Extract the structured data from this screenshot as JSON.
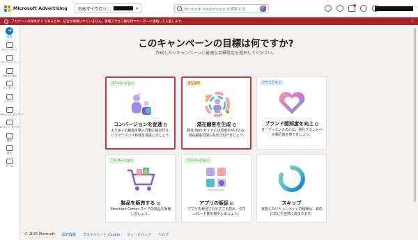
{
  "brand": {
    "name": "Microsoft Advertising",
    "logo_colors": [
      "#f25022",
      "#7fba00",
      "#00a4ef",
      "#ffb900"
    ]
  },
  "account": {
    "name": "日本マイクロソ..."
  },
  "search": {
    "placeholder": "Microsoft Advertising を検索する"
  },
  "top_icons": [
    "lightbulb-icon",
    "megaphone-icon",
    "bell-icon",
    "help-icon",
    "gear-icon"
  ],
  "alert": {
    "text": "アカウントの残高が 0 であるため、広告が掲載されていません。管理アクセス権を持つユーザーに連絡して入金します。",
    "color": "#a4262c"
  },
  "sidebar": {
    "items": [
      {
        "label": "作成",
        "icon": "plus-icon"
      },
      {
        "label": "キャンペーン",
        "icon": "megaphone-icon"
      },
      {
        "label": "コンバージョン",
        "icon": "conversion-icon"
      },
      {
        "label": "Ads Studio",
        "icon": "studio-icon"
      },
      {
        "label": "インポート",
        "icon": "import-icon"
      },
      {
        "label": "レポート",
        "icon": "report-icon"
      },
      {
        "label": "マーチャント センター",
        "icon": "store-icon"
      },
      {
        "label": "プロパティ センター",
        "icon": "property-icon"
      },
      {
        "label": "請求",
        "icon": "billing-icon"
      },
      {
        "label": "設定",
        "icon": "settings-icon"
      },
      {
        "label": "ツール",
        "icon": "tools-icon"
      }
    ]
  },
  "page": {
    "title": "このキャンペーンの目標は何ですか?",
    "subtitle": "作成したいキャンペーンに最適な目標設定を選択してください。"
  },
  "cards": [
    {
      "badge": "コンバージョン",
      "title": "コンバージョンを促進",
      "desc": "より多くの顧客を購入行動に結び付け、パフォーマンス目標を達成しましょう。",
      "selected": true
    },
    {
      "badge": "潜在顧客",
      "title": "潜在顧客を生成",
      "desc": "貴社 Web サイトに訪問者を呼び込み、潜在顧客の関心を引き付けましょう。",
      "selected": true
    },
    {
      "badge": "アウェアネス",
      "title": "ブランド認知度を向上",
      "desc": "オーディエンスの心に、貴社ブランドへの親近感を育てましょう。",
      "selected": false
    },
    {
      "badge": "コンバージョン",
      "title": "製品を販売する",
      "desc": "Merchant Center ストアの商品を販売しましょう。",
      "selected": false
    },
    {
      "badge": "コンバージョン",
      "title": "アプリの販促",
      "desc": "アプリの発見されやすさを高め、ダウンロード数を増やしましょう。",
      "selected": false
    },
    {
      "badge": "",
      "title": "スキップ",
      "desc": "実施したいキャンペーンの種類は、目的に応じて自然に決まります。",
      "selected": false
    }
  ],
  "footer": {
    "copyright": "© 2025 Microsoft",
    "links": [
      "法的情報",
      "プライバシーと Cookie",
      "フィードバック",
      "ヘルプ"
    ]
  }
}
